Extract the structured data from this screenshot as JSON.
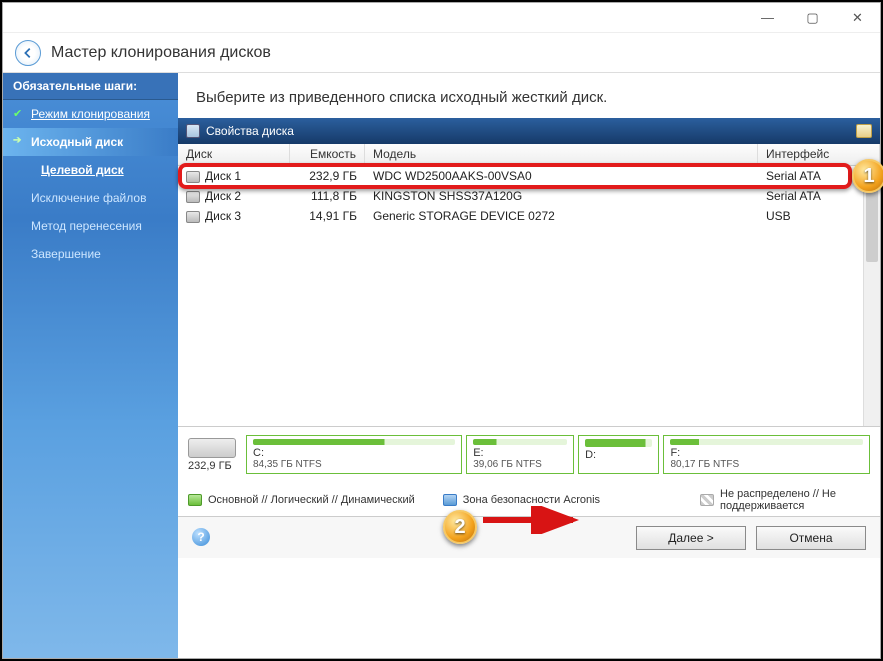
{
  "window": {
    "title": "Мастер клонирования дисков"
  },
  "sidebar": {
    "header": "Обязательные шаги:",
    "steps": [
      {
        "label": "Режим клонирования"
      },
      {
        "label": "Исходный диск"
      },
      {
        "label": "Целевой диск"
      },
      {
        "label": "Исключение файлов"
      },
      {
        "label": "Метод перенесения"
      },
      {
        "label": "Завершение"
      }
    ]
  },
  "main": {
    "heading": "Выберите из приведенного списка исходный жесткий диск.",
    "properties_label": "Свойства диска",
    "columns": {
      "disk": "Диск",
      "capacity": "Емкость",
      "model": "Модель",
      "interface": "Интерфейс"
    },
    "rows": [
      {
        "disk": "Диск 1",
        "capacity": "232,9 ГБ",
        "model": "WDC WD2500AAKS-00VSA0",
        "interface": "Serial ATA"
      },
      {
        "disk": "Диск 2",
        "capacity": "111,8 ГБ",
        "model": "KINGSTON SHSS37A120G",
        "interface": "Serial ATA"
      },
      {
        "disk": "Диск 3",
        "capacity": "14,91 ГБ",
        "model": "Generic STORAGE DEVICE 0272",
        "interface": "USB"
      }
    ],
    "total_capacity": "232,9 ГБ",
    "partitions": [
      {
        "letter": "C:",
        "info": "84,35 ГБ  NTFS"
      },
      {
        "letter": "E:",
        "info": "39,06 ГБ  NTFS"
      },
      {
        "letter": "D:",
        "info": ""
      },
      {
        "letter": "F:",
        "info": "80,17 ГБ  NTFS"
      }
    ],
    "legend": {
      "primary": "Основной // Логический // Динамический",
      "acronis": "Зона безопасности Acronis",
      "unalloc": "Не распределено // Не поддерживается"
    }
  },
  "footer": {
    "next": "Далее >",
    "cancel": "Отмена"
  },
  "annotations": {
    "m1": "1",
    "m2": "2"
  }
}
